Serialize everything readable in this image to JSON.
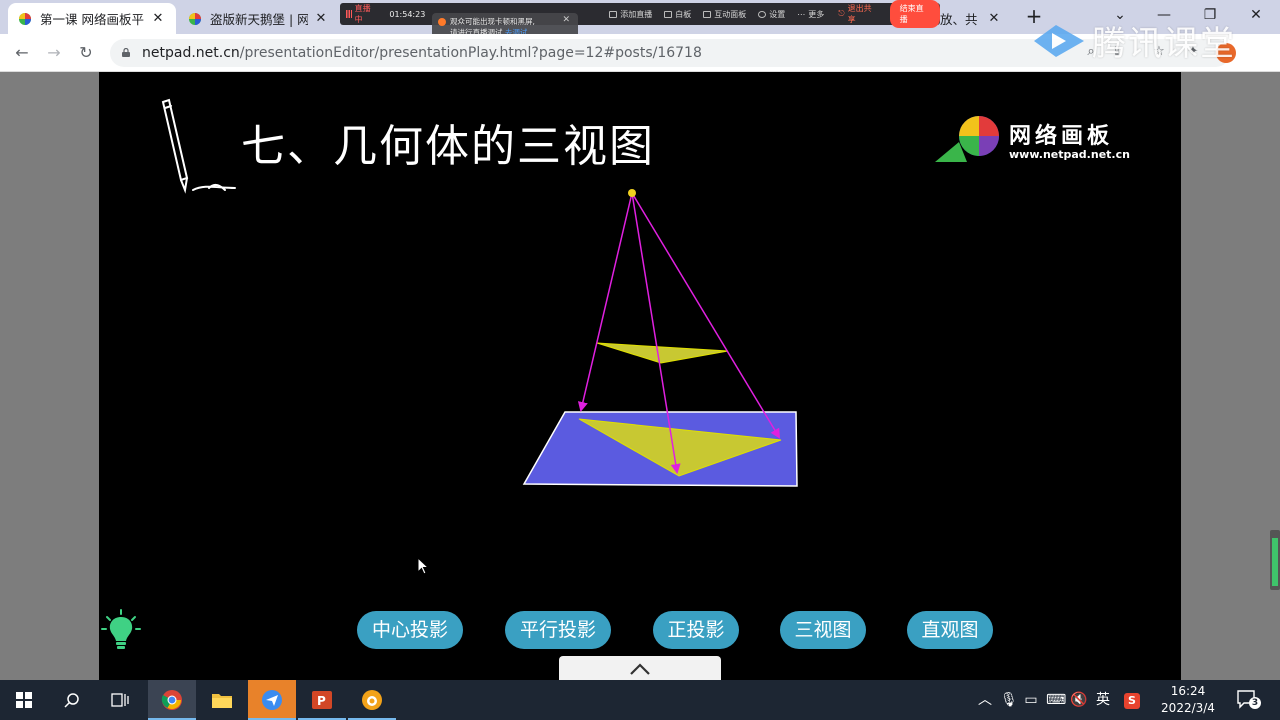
{
  "browser": {
    "tabs": [
      {
        "title": "第一课 网络画板平",
        "active": true
      },
      {
        "title": "盗版新天鹅堡 | 网络",
        "active": false
      },
      {
        "title": "放、共",
        "active": false
      }
    ],
    "url_host": "netpad.net.cn",
    "url_path": "/presentationEditor/presentationPlay.html?page=12#posts/16718"
  },
  "live_overlay": {
    "status": "直播中",
    "timer": "01:54:23",
    "tools": [
      "添加直播",
      "白板",
      "互动面板",
      "设置",
      "更多"
    ],
    "exit_share": "退出共享",
    "end_live": "结束直播",
    "tooltip_line1": "观众可能出现卡顿和黑屏,",
    "tooltip_line2": "请进行直播调试",
    "tooltip_link": "去调试"
  },
  "watermark": {
    "text": "腾讯课堂"
  },
  "slide": {
    "title": "七、几何体的三视图",
    "brand_name": "网络画板",
    "brand_url": "www.netpad.net.cn",
    "buttons": [
      "中心投影",
      "平行投影",
      "正投影",
      "三视图",
      "直观图"
    ]
  },
  "colors": {
    "plane": "#5b5be0",
    "triangle": "#c8c832",
    "rays": "#e020e0",
    "button": "#3aa0c2"
  },
  "taskbar": {
    "ime": "英",
    "time": "16:24",
    "date": "2022/3/4",
    "notifications": "3"
  }
}
